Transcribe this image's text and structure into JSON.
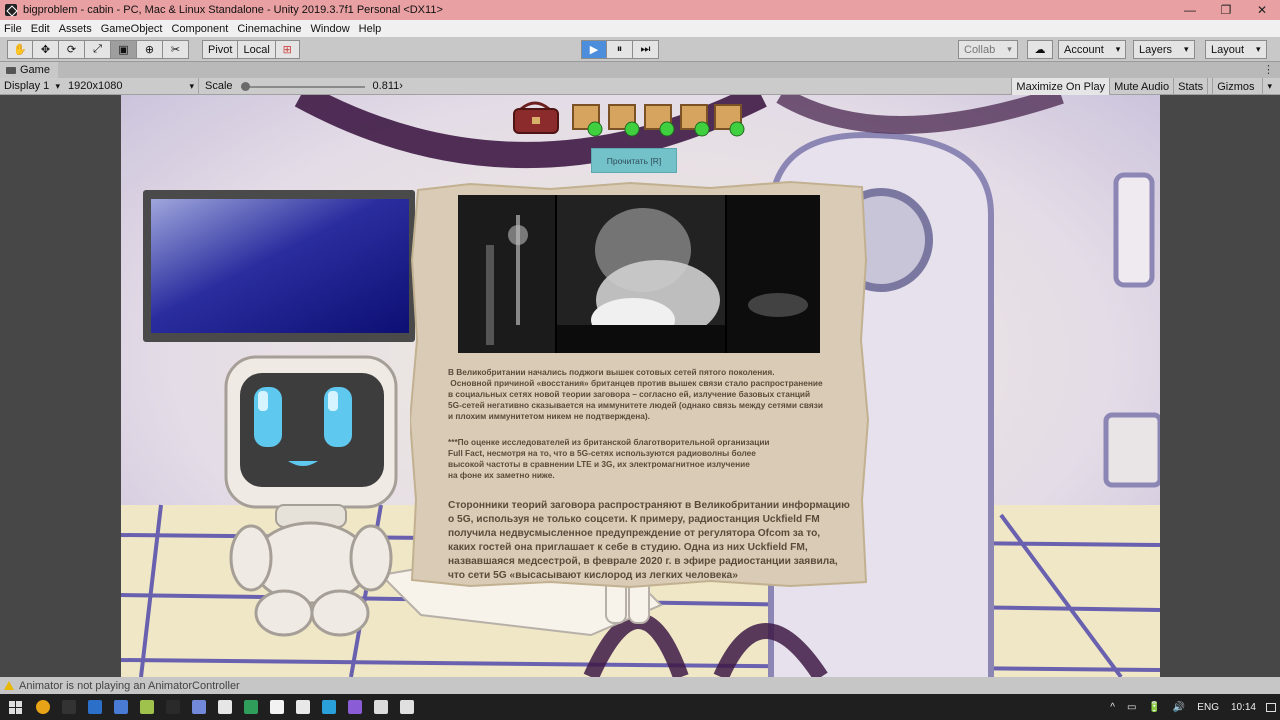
{
  "window": {
    "title": "bigproblem - cabin - PC, Mac & Linux Standalone - Unity 2019.3.7f1 Personal <DX11>",
    "controls": [
      "—",
      "❐",
      "✕"
    ]
  },
  "menu": [
    "File",
    "Edit",
    "Assets",
    "GameObject",
    "Component",
    "Cinemachine",
    "Window",
    "Help"
  ],
  "toolbar": {
    "tools": [
      "✋",
      "✥",
      "⟳",
      "⤢",
      "▣",
      "⊕",
      "✂"
    ],
    "pivot": "Pivot",
    "local": "Local",
    "play": "▶",
    "pause": "⏸",
    "step": "⏭",
    "collab": "Collab",
    "cloud": "☁",
    "account": "Account",
    "layers": "Layers",
    "layout": "Layout"
  },
  "game_tab": {
    "label": "Game",
    "more": "⋮"
  },
  "game_bar": {
    "display": "Display 1",
    "resolution": "1920x1080",
    "scale_label": "Scale",
    "scale_value": "0.811",
    "scale_fraction": 0.0,
    "maximize": "Maximize On Play",
    "mute": "Mute Audio",
    "stats": "Stats",
    "gizmos": "Gizmos"
  },
  "game": {
    "read_button": "Прочитать [R]",
    "items_collected": 5,
    "paragraph1": [
      "В Великобритании начались поджоги вышек сотовых сетей пятого поколения.",
      " Основной причиной «восстания» британцев против вышек связи стало распространение",
      "в социальных сетях новой теории заговора – согласно ей, излучение базовых станций",
      "5G-сетей негативно сказывается на иммунитете людей (однако связь между сетями связи",
      "и плохим иммунитетом никем не подтверждена)."
    ],
    "paragraph2": [
      "***По оценке исследователей из британской благотворительной организации",
      "Full Fact, несмотря на то, что в 5G-сетях используются радиоволны более",
      "высокой частоты в сравнении LTE и 3G, их электромагнитное излучение",
      "на фоне их заметно ниже."
    ],
    "paragraph3": [
      "Сторонники теорий заговора распространяют в Великобритании информацию",
      "о 5G, используя не только соцсети. К примеру, радиостанция Uckfield FM",
      "получила недвусмысленное предупреждение от регулятора Ofcom за то,",
      "каких гостей она приглашает к себе в студию. Одна из них Uckfield FM,",
      "назвавшаяся медсестрой, в феврале 2020 г. в эфире радиостанции заявила,",
      "что сети 5G «высасывают кислород из легких человека»"
    ]
  },
  "status": {
    "message": "Animator is not playing an AnimatorController"
  },
  "taskbar": {
    "apps": [
      "#e8a317",
      "#333333",
      "#2b6fc9",
      "#4a7bd4",
      "#9fc24c",
      "#2a2a2a",
      "#7289da",
      "#e6e6e6",
      "#2e9e5a",
      "#f2f2f2",
      "#e8e8e8",
      "#2aa0da",
      "#8a5cd6",
      "#dcdcdc",
      "#e0e0e0"
    ],
    "language": "ENG",
    "time": "10:14",
    "tray_icons": [
      "^",
      "▭",
      "🔋",
      "🔊"
    ]
  }
}
